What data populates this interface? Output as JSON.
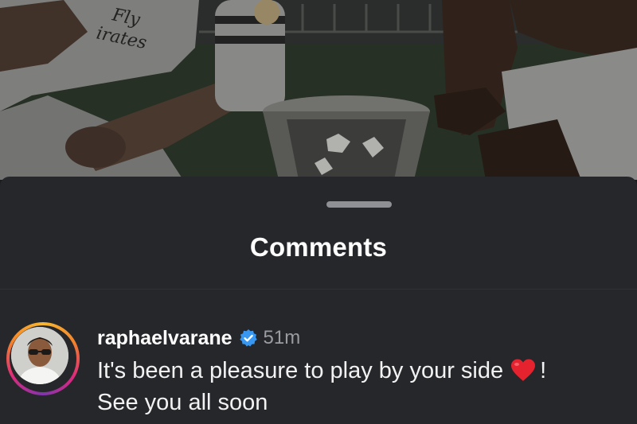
{
  "sheet": {
    "title": "Comments"
  },
  "comment": {
    "username": "raphaelvarane",
    "verified": true,
    "time": "51m",
    "line1": "It's been a pleasure to play by your side",
    "line1_end": "!",
    "line2": "See you all soon"
  },
  "photo": {
    "jersey_text_1": "Fly",
    "jersey_text_2": "irates"
  },
  "icons": {
    "verified": "verified-badge-icon",
    "heart": "red-heart-emoji-icon",
    "drag": "drag-handle"
  },
  "colors": {
    "sheet_bg": "#26272b",
    "verified_blue": "#3897f0",
    "heart_red": "#e5232f"
  }
}
